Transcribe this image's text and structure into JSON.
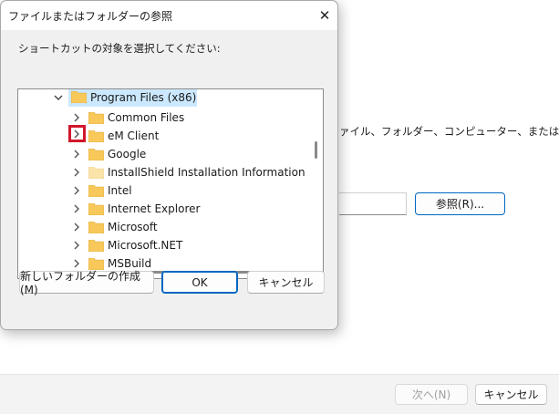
{
  "background_window": {
    "description": "ァイル、フォルダー、コンピューター、またはイン",
    "browse_label": "参照(R)...",
    "next_label": "次へ(N)",
    "cancel_label": "キャンセル"
  },
  "dialog": {
    "title": "ファイルまたはフォルダーの参照",
    "close_glyph": "✕",
    "prompt": "ショートカットの対象を選択してください:",
    "tree": {
      "parent": {
        "label": "Program Files (x86)",
        "expanded": true,
        "selected": true
      },
      "children": [
        {
          "label": "Common Files",
          "folder_style": "normal"
        },
        {
          "label": "eM Client",
          "folder_style": "normal",
          "chevron_highlighted": true
        },
        {
          "label": "Google",
          "folder_style": "normal"
        },
        {
          "label": "InstallShield Installation Information",
          "folder_style": "pale"
        },
        {
          "label": "Intel",
          "folder_style": "normal"
        },
        {
          "label": "Internet Explorer",
          "folder_style": "normal"
        },
        {
          "label": "Microsoft",
          "folder_style": "normal"
        },
        {
          "label": "Microsoft.NET",
          "folder_style": "normal"
        },
        {
          "label": "MSBuild",
          "folder_style": "normal"
        }
      ]
    },
    "buttons": {
      "new_folder": "新しいフォルダーの作成(M)",
      "ok": "OK",
      "cancel": "キャンセル"
    }
  },
  "colors": {
    "accent": "#0067c0",
    "highlight_box": "#d1172c",
    "selection": "#cce8ff",
    "folder": "#f8c95a",
    "folder_pale": "#fbe3a9"
  }
}
